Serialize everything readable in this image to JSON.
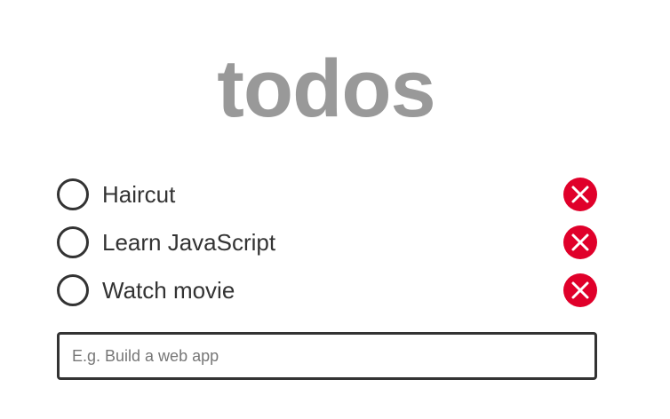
{
  "app": {
    "title": "todos"
  },
  "todos": [
    {
      "text": "Haircut",
      "completed": false
    },
    {
      "text": "Learn JavaScript",
      "completed": false
    },
    {
      "text": "Watch movie",
      "completed": false
    }
  ],
  "new_todo": {
    "value": "",
    "placeholder": "E.g. Build a web app"
  },
  "icons": {
    "toggle": "circle-outline-icon",
    "delete": "close-circle-icon"
  },
  "colors": {
    "title": "#999999",
    "text": "#333333",
    "delete": "#e0002a",
    "border": "#333333"
  }
}
